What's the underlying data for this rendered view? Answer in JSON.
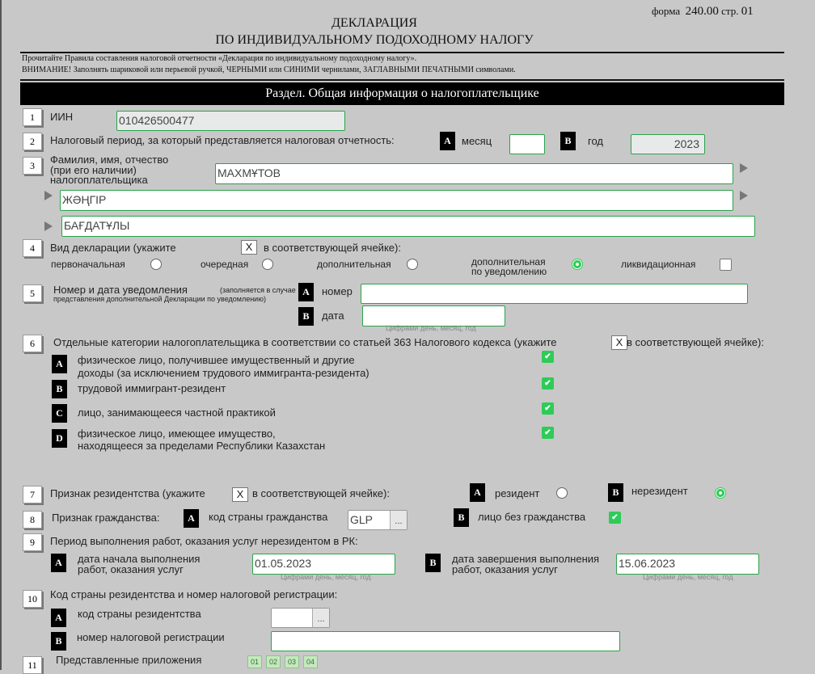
{
  "header": {
    "title_line1": "ДЕКЛАРАЦИЯ",
    "title_line2": "ПО ИНДИВИДУАЛЬНОМУ ПОДОХОДНОМУ НАЛОГУ",
    "form_label": "форма",
    "form_number": "240.00",
    "page_label": "стр.",
    "page_number": "01",
    "note1": "Прочитайте Правила составления налоговой отчетности «Декларация по индивидуальному подоходному налогу».",
    "note2": "ВНИМАНИЕ! Заполнять шариковой или перьевой ручкой, ЧЕРНЫМИ или СИНИМИ чернилами, ЗАГЛАВНЫМИ ПЕЧАТНЫМИ символами."
  },
  "section_title": "Раздел. Общая информация о налогоплательщике",
  "fields": {
    "f1": {
      "num": "1",
      "label": "ИИН",
      "value": "010426500477"
    },
    "f2": {
      "num": "2",
      "label": "Налоговый период, за который представляется налоговая отчетность:",
      "a": "A",
      "a_label": "месяц",
      "month_value": "",
      "b": "B",
      "b_label": "год",
      "year_value": "2023"
    },
    "f3": {
      "num": "3",
      "label_l1": "Фамилия, имя, отчество",
      "label_l2": "(при его наличии)",
      "label_l3": "налогоплательщика",
      "last_name": "МАХМҰТОВ",
      "first_name": "ЖӘҢГІР",
      "patronymic": "БАҒДАТҰЛЫ"
    },
    "f4": {
      "num": "4",
      "label_start": "Вид  декларации  (укажите",
      "x": "X",
      "label_end": "в соответствующей ячейке):",
      "opt1": "первоначальная",
      "opt2": "очередная",
      "opt3": "дополнительная",
      "opt4_l1": "дополнительная",
      "opt4_l2": "по уведомлению",
      "opt5": "ликвидационная"
    },
    "f5": {
      "num": "5",
      "label": "Номер и дата уведомления",
      "note_l1": "(заполняется в случае",
      "note_l2": "представления дополнительной Декларации по уведомлению)",
      "a": "A",
      "a_label": "номер",
      "number_value": "",
      "b": "B",
      "b_label": "дата",
      "date_value": "",
      "date_hint": "Цифрами день, месяц, год"
    },
    "f6": {
      "num": "6",
      "label_start": "Отдельные категории налогоплательщика в соответствии со статьей 363 Налогового кодекса   (укажите",
      "x": "X",
      "label_end": "в соответствующей ячейке):",
      "a": "A",
      "a_l1": "физическое лицо, получившее имущественный и другие",
      "a_l2": "доходы (за исключением трудового иммигранта-резидента)",
      "b": "B",
      "b_label": "трудовой иммигрант-резидент",
      "c": "C",
      "c_label": "лицо, занимающееся частной практикой",
      "d": "D",
      "d_l1": "физическое лицо, имеющее имущество,",
      "d_l2": "находящееся за пределами Республики Казахстан",
      "check": "✔"
    },
    "f7": {
      "num": "7",
      "label_start": "Признак  резидентства  (укажите",
      "x": "X",
      "label_end": "в соответствующей ячейке):",
      "a": "A",
      "a_label": "резидент",
      "b": "B",
      "b_label": "нерезидент"
    },
    "f8": {
      "num": "8",
      "label": "Признак гражданства:",
      "a": "A",
      "a_label": "код страны гражданства",
      "country_code": "GLP",
      "picker": "...",
      "b": "B",
      "b_label": "лицо без гражданства",
      "check": "✔"
    },
    "f9": {
      "num": "9",
      "label": "Период выполнения работ, оказания услуг нерезидентом в РК:",
      "a": "A",
      "a_l1": "дата начала выполнения",
      "a_l2": "работ, оказания услуг",
      "start_date": "01.05.2023",
      "b": "B",
      "b_l1": "дата завершения выполнения",
      "b_l2": "работ, оказания услуг",
      "end_date": "15.06.2023",
      "hint": "Цифрами день, месяц, год"
    },
    "f10": {
      "num": "10",
      "label": "Код страны резидентства и номер налоговой регистрации:",
      "a": "A",
      "a_label": "код страны резидентства",
      "country_value": "",
      "picker": "...",
      "b": "B",
      "b_label": "номер налоговой регистрации",
      "reg_value": ""
    },
    "f11": {
      "num": "11",
      "label": "Представленные приложения",
      "apps": [
        "01",
        "02",
        "03",
        "04"
      ]
    }
  },
  "colors": {
    "accent_green": "#2ecc57",
    "border_green": "#2aa34a",
    "background": "#c8c8c8"
  }
}
